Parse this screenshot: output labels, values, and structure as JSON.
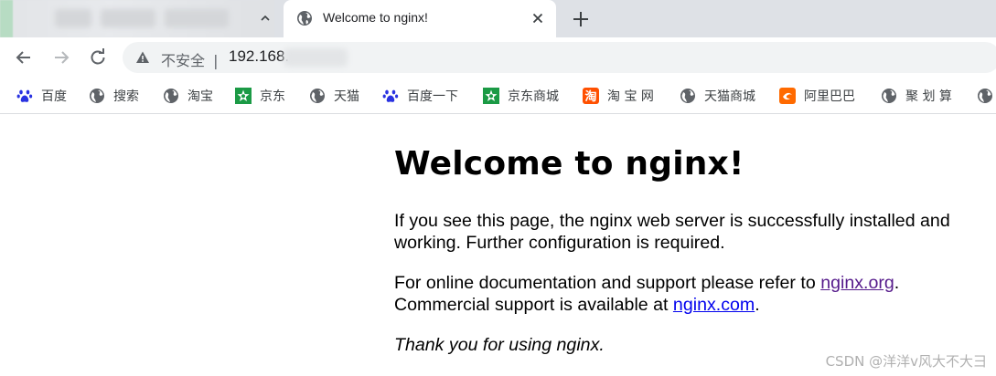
{
  "tab": {
    "title": "Welcome to nginx!",
    "chevron": "^",
    "globe_icon": "globe-icon",
    "close_icon": "close-icon",
    "new_tab_icon": "plus-icon"
  },
  "toolbar": {
    "back_icon": "arrow-left-icon",
    "forward_icon": "arrow-right-icon",
    "reload_icon": "reload-icon",
    "security_label": "不安全",
    "separator": "|",
    "url": "192.168."
  },
  "bookmarks": [
    {
      "label": "百度",
      "icon": "paw-icon",
      "color": "#2932e1"
    },
    {
      "label": "搜索",
      "icon": "globe-icon",
      "color": "#5f6368"
    },
    {
      "label": "淘宝",
      "icon": "globe-icon",
      "color": "#5f6368"
    },
    {
      "label": "京东",
      "icon": "jd-icon",
      "color": "#1b9a45"
    },
    {
      "label": "天猫",
      "icon": "globe-icon",
      "color": "#5f6368"
    },
    {
      "label": "百度一下",
      "icon": "paw-icon",
      "color": "#2932e1"
    },
    {
      "label": "京东商城",
      "icon": "jd-icon",
      "color": "#1b9a45"
    },
    {
      "label": "淘 宝 网",
      "icon": "taobao-icon",
      "color": "#ff5000"
    },
    {
      "label": "天猫商城",
      "icon": "globe-icon",
      "color": "#5f6368"
    },
    {
      "label": "阿里巴巴",
      "icon": "alibaba-icon",
      "color": "#ff6a00"
    },
    {
      "label": "聚 划 算",
      "icon": "globe-icon",
      "color": "#5f6368"
    }
  ],
  "page": {
    "heading": "Welcome to nginx!",
    "p1": "If you see this page, the nginx web server is successfully installed and working. Further configuration is required.",
    "p2_before": "For online documentation and support please refer to ",
    "link1": "nginx.org",
    "p2_mid": ".",
    "p2_line2": "Commercial support is available at ",
    "link2": "nginx.com",
    "p2_end": ".",
    "p3": "Thank you for using nginx."
  },
  "watermark": "CSDN @洋洋v风大不大彐"
}
